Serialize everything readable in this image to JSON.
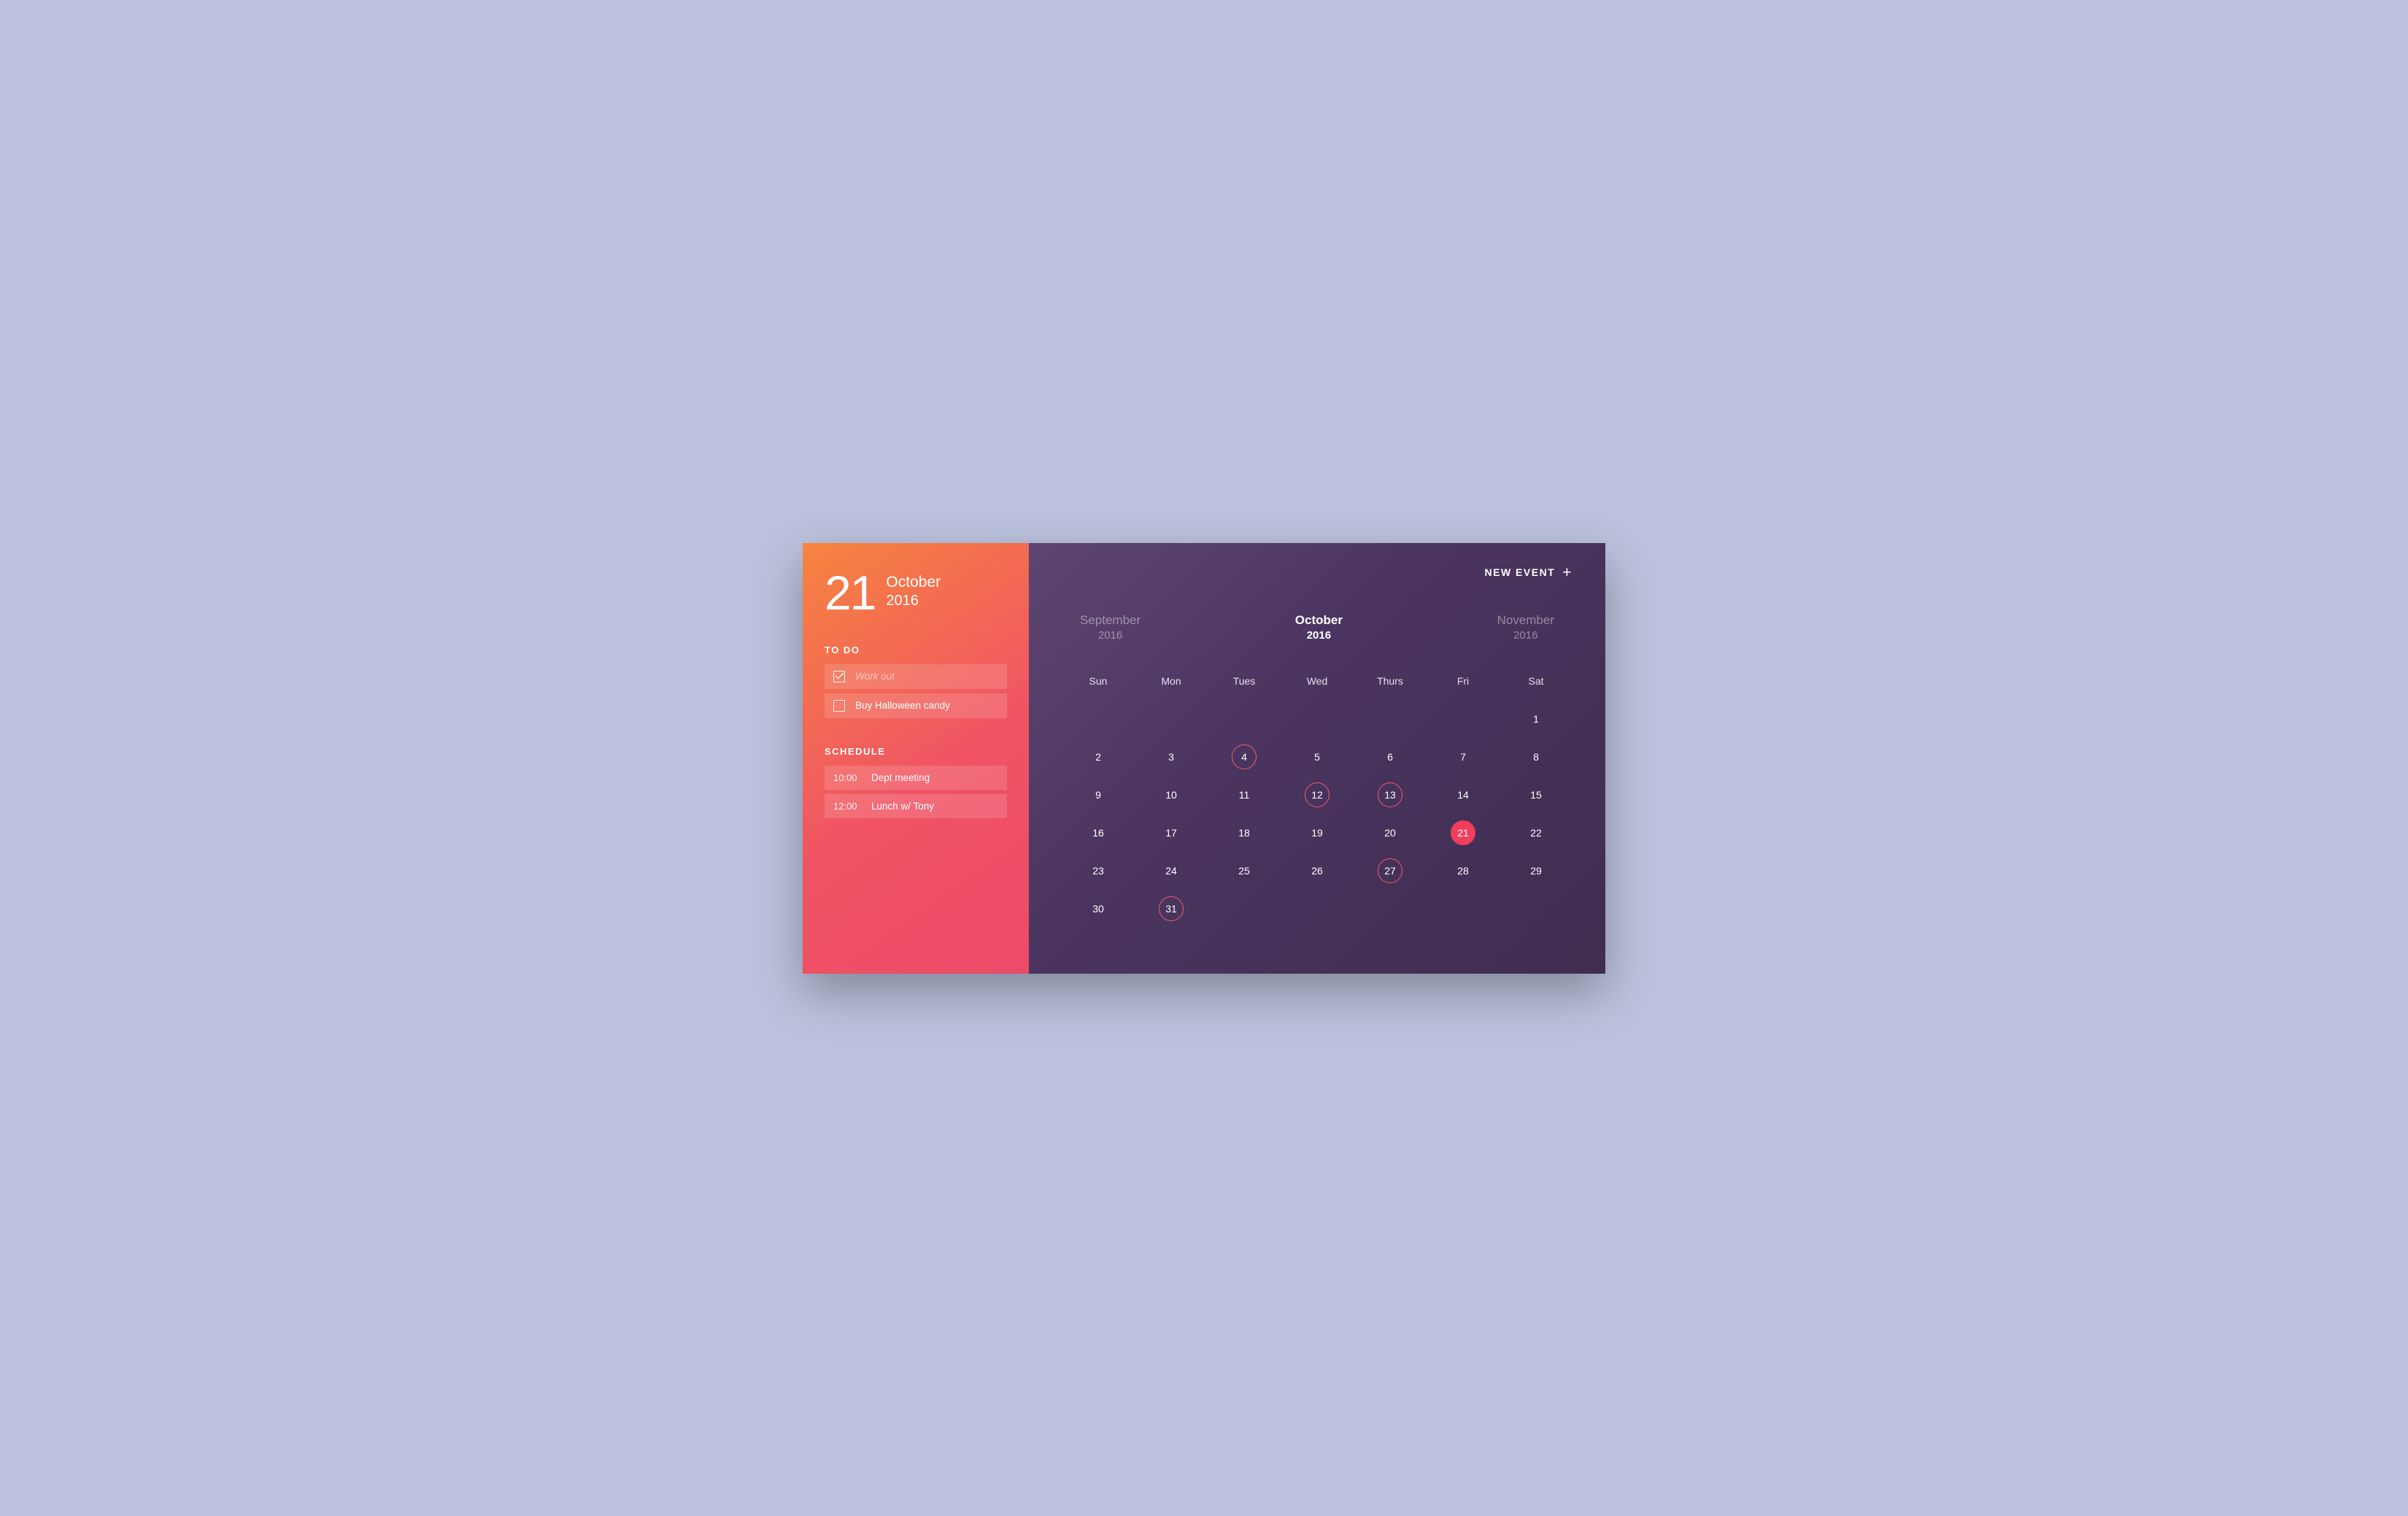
{
  "sidebar": {
    "day": "21",
    "month": "October",
    "year": "2016",
    "todo_heading": "TO DO",
    "schedule_heading": "SCHEDULE",
    "todos": [
      {
        "text": "Work out",
        "completed": true
      },
      {
        "text": "Buy Halloween candy",
        "completed": false
      }
    ],
    "schedule": [
      {
        "time": "10:00",
        "title": "Dept meeting"
      },
      {
        "time": "12:00",
        "title": "Lunch w/ Tony"
      }
    ]
  },
  "calendar": {
    "new_event_label": "NEW EVENT",
    "months": {
      "prev": {
        "month": "September",
        "year": "2016"
      },
      "current": {
        "month": "October",
        "year": "2016"
      },
      "next": {
        "month": "November",
        "year": "2016"
      }
    },
    "weekdays": [
      "Sun",
      "Mon",
      "Tues",
      "Wed",
      "Thurs",
      "Fri",
      "Sat"
    ],
    "weeks": [
      [
        null,
        null,
        null,
        null,
        null,
        null,
        {
          "d": 1
        }
      ],
      [
        {
          "d": 2
        },
        {
          "d": 3
        },
        {
          "d": 4,
          "event": true
        },
        {
          "d": 5
        },
        {
          "d": 6
        },
        {
          "d": 7
        },
        {
          "d": 8
        }
      ],
      [
        {
          "d": 9
        },
        {
          "d": 10
        },
        {
          "d": 11
        },
        {
          "d": 12,
          "event": true
        },
        {
          "d": 13,
          "event": true
        },
        {
          "d": 14
        },
        {
          "d": 15
        }
      ],
      [
        {
          "d": 16
        },
        {
          "d": 17
        },
        {
          "d": 18
        },
        {
          "d": 19
        },
        {
          "d": 20
        },
        {
          "d": 21,
          "selected": true
        },
        {
          "d": 22
        }
      ],
      [
        {
          "d": 23
        },
        {
          "d": 24
        },
        {
          "d": 25
        },
        {
          "d": 26
        },
        {
          "d": 27,
          "event": true
        },
        {
          "d": 28
        },
        {
          "d": 29
        }
      ],
      [
        {
          "d": 30
        },
        {
          "d": 31,
          "event": true
        },
        null,
        null,
        null,
        null,
        null
      ]
    ]
  }
}
